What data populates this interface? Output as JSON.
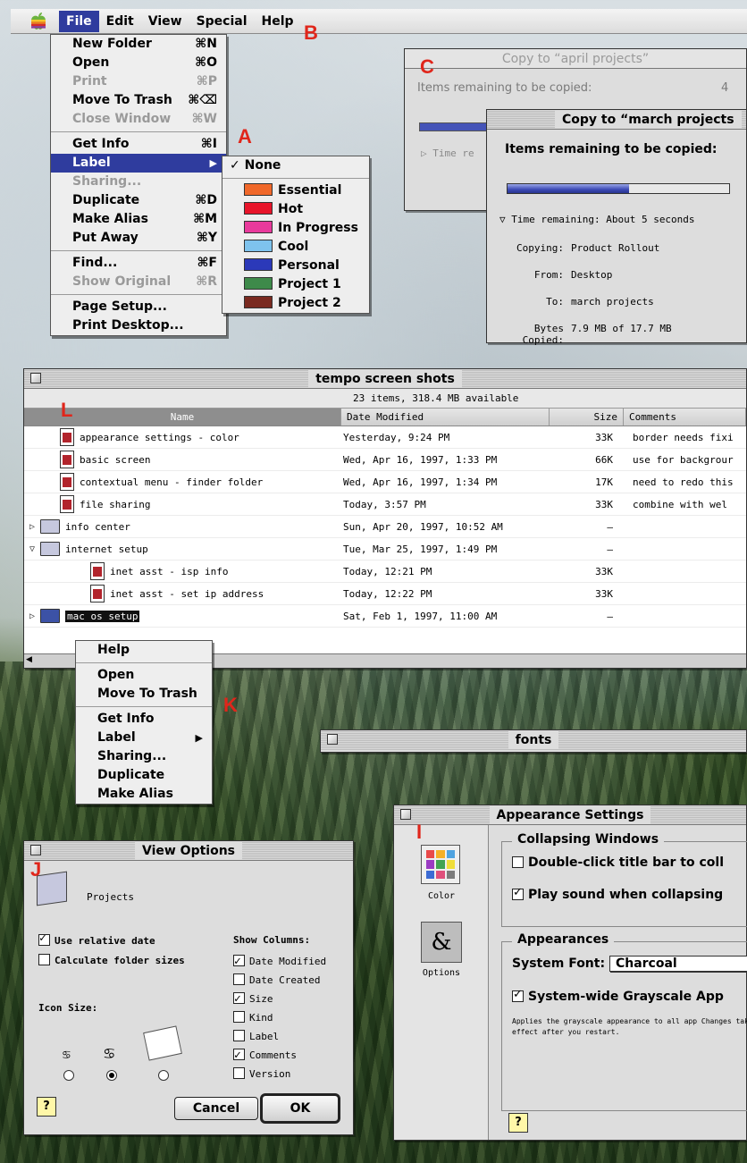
{
  "menubar": {
    "items": [
      "File",
      "Edit",
      "View",
      "Special",
      "Help"
    ]
  },
  "file_menu": {
    "items": [
      {
        "label": "New Folder",
        "shortcut": "⌘N",
        "disabled": false
      },
      {
        "label": "Open",
        "shortcut": "⌘O",
        "disabled": false
      },
      {
        "label": "Print",
        "shortcut": "⌘P",
        "disabled": true
      },
      {
        "label": "Move To Trash",
        "shortcut": "⌘⌫",
        "disabled": false
      },
      {
        "label": "Close Window",
        "shortcut": "⌘W",
        "disabled": true
      },
      {
        "label": "Get Info",
        "shortcut": "⌘I",
        "disabled": false
      },
      {
        "label": "Label",
        "shortcut": "",
        "disabled": false
      },
      {
        "label": "Sharing...",
        "shortcut": "",
        "disabled": true
      },
      {
        "label": "Duplicate",
        "shortcut": "⌘D",
        "disabled": false
      },
      {
        "label": "Make Alias",
        "shortcut": "⌘M",
        "disabled": false
      },
      {
        "label": "Put Away",
        "shortcut": "⌘Y",
        "disabled": false
      },
      {
        "label": "Find...",
        "shortcut": "⌘F",
        "disabled": false
      },
      {
        "label": "Show Original",
        "shortcut": "⌘R",
        "disabled": true
      },
      {
        "label": "Page Setup...",
        "shortcut": "",
        "disabled": false
      },
      {
        "label": "Print Desktop...",
        "shortcut": "",
        "disabled": false
      }
    ]
  },
  "label_menu": {
    "none": "None",
    "items": [
      {
        "label": "Essential",
        "color": "#f0682a"
      },
      {
        "label": "Hot",
        "color": "#e8142a"
      },
      {
        "label": "In Progress",
        "color": "#e93a9c"
      },
      {
        "label": "Cool",
        "color": "#7ec3ee"
      },
      {
        "label": "Personal",
        "color": "#2b39b9"
      },
      {
        "label": "Project 1",
        "color": "#3e8a4a"
      },
      {
        "label": "Project 2",
        "color": "#7a2a20"
      }
    ]
  },
  "copy_april": {
    "title": "Copy to “april projects”",
    "remaining_label": "Items remaining to be copied:",
    "remaining_value": "4",
    "time_label": "Time re"
  },
  "copy_march": {
    "title": "Copy to “march projects",
    "remaining_label": "Items remaining to be copied:",
    "progress": 0.55,
    "time": "Time remaining: About 5 seconds",
    "copying_label": "Copying:",
    "copying_value": "Product Rollout",
    "from_label": "From:",
    "from_value": "Desktop",
    "to_label": "To:",
    "to_value": "march projects",
    "bytes_label": "Bytes Copied:",
    "bytes_value": "7.9 MB of 17.7 MB"
  },
  "list_window": {
    "title": "tempo screen shots",
    "info": "23 items, 318.4 MB available",
    "columns": {
      "name": "Name",
      "date": "Date Modified",
      "size": "Size",
      "comments": "Comments"
    },
    "rows": [
      {
        "name": "appearance settings - color",
        "date": "Yesterday, 9:24 PM",
        "size": "33K",
        "comments": "border needs fixi"
      },
      {
        "name": "basic screen",
        "date": "Wed, Apr 16, 1997, 1:33 PM",
        "size": "66K",
        "comments": "use for backgrour"
      },
      {
        "name": "contextual menu - finder folder",
        "date": "Wed, Apr 16, 1997, 1:34 PM",
        "size": "17K",
        "comments": "need to redo this"
      },
      {
        "name": "file sharing",
        "date": "Today, 3:57 PM",
        "size": "33K",
        "comments": "combine with wel"
      },
      {
        "name": "info center",
        "date": "Sun, Apr 20, 1997, 10:52 AM",
        "size": "–",
        "comments": ""
      },
      {
        "name": "internet setup",
        "date": "Tue, Mar 25, 1997, 1:49 PM",
        "size": "–",
        "comments": ""
      },
      {
        "name": "inet asst - isp info",
        "date": "Today, 12:21 PM",
        "size": "33K",
        "comments": ""
      },
      {
        "name": "inet asst - set ip address",
        "date": "Today, 12:22 PM",
        "size": "33K",
        "comments": ""
      },
      {
        "name": "mac os setup",
        "date": "Sat, Feb 1, 1997, 11:00 AM",
        "size": "–",
        "comments": ""
      }
    ]
  },
  "context_menu": {
    "items": [
      "Help",
      "Open",
      "Move To Trash",
      "Get Info",
      "Label",
      "Sharing...",
      "Duplicate",
      "Make Alias"
    ]
  },
  "fonts_window": {
    "title": "fonts"
  },
  "appearance": {
    "title": "Appearance Settings",
    "sidebar": [
      "Color",
      "Options"
    ],
    "collapsing_heading": "Collapsing Windows",
    "double_click": "Double-click title bar to coll",
    "play_sound": "Play sound when collapsing",
    "appearances_heading": "Appearances",
    "system_font_label": "System Font:",
    "system_font_value": "Charcoal",
    "grayscale": "System-wide Grayscale App",
    "note": "Applies the grayscale appearance to all app Changes take effect after you restart.",
    "help": "?"
  },
  "view_options": {
    "title": "View Options",
    "folder_name": "Projects",
    "use_relative_date": "Use relative date",
    "calc_folder_sizes": "Calculate folder sizes",
    "icon_size_label": "Icon Size:",
    "show_columns_label": "Show Columns:",
    "columns": [
      {
        "label": "Date Modified",
        "checked": true
      },
      {
        "label": "Date Created",
        "checked": false
      },
      {
        "label": "Size",
        "checked": true
      },
      {
        "label": "Kind",
        "checked": false
      },
      {
        "label": "Label",
        "checked": false
      },
      {
        "label": "Comments",
        "checked": true
      },
      {
        "label": "Version",
        "checked": false
      }
    ],
    "cancel": "Cancel",
    "ok": "OK",
    "help": "?"
  },
  "callouts": [
    "A",
    "B",
    "C",
    "I",
    "J",
    "K",
    "L"
  ]
}
